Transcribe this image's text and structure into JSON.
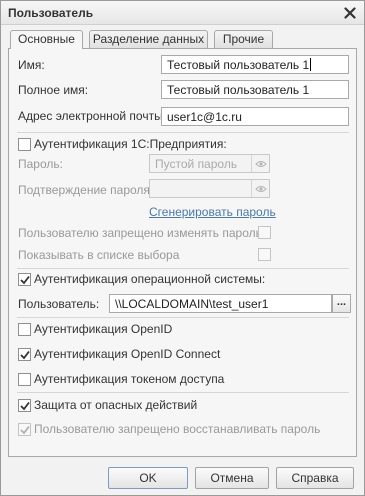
{
  "window": {
    "title": "Пользователь"
  },
  "tabs": [
    {
      "label": "Основные",
      "active": true
    },
    {
      "label": "Разделение данных",
      "active": false
    },
    {
      "label": "Прочие",
      "active": false
    }
  ],
  "fields": {
    "name_label": "Имя:",
    "name_value": "Тестовый пользователь 1",
    "fullname_label": "Полное имя:",
    "fullname_value": "Тестовый пользователь 1",
    "email_label": "Адрес электронной почты:",
    "email_value": "user1c@1c.ru"
  },
  "auth_1c": {
    "label": "Аутентификация 1С:Предприятия:",
    "checked": false,
    "password_label": "Пароль:",
    "password_placeholder": "Пустой пароль",
    "confirm_label": "Подтверждение пароля:",
    "confirm_value": "",
    "generate_link": "Сгенерировать пароль",
    "forbid_change_label": "Пользователю запрещено изменять пароль",
    "show_in_list_label": "Показывать в списке выбора"
  },
  "auth_os": {
    "label": "Аутентификация операционной системы:",
    "checked": true,
    "user_label": "Пользователь:",
    "user_value": "\\\\LOCALDOMAIN\\test_user1",
    "select_button": "..."
  },
  "auth_openid": {
    "label": "Аутентификация OpenID",
    "checked": false
  },
  "auth_openid_connect": {
    "label": "Аутентификация OpenID Connect",
    "checked": true
  },
  "auth_token": {
    "label": "Аутентификация токеном доступа",
    "checked": false
  },
  "protection": {
    "label": "Защита от опасных действий",
    "checked": true
  },
  "forbid_restore": {
    "label": "Пользователю запрещено восстанавливать пароль",
    "checked": true
  },
  "buttons": {
    "ok": "OK",
    "cancel": "Отмена",
    "help": "Справка"
  },
  "colors": {
    "link": "#4a7aa6",
    "disabled_text": "#999999",
    "checkmark": "#333333"
  }
}
